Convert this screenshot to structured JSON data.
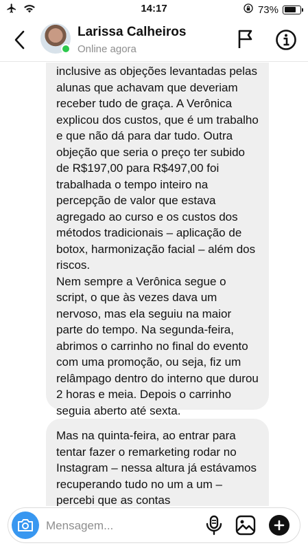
{
  "status_bar": {
    "time": "14:17",
    "battery": "73%",
    "battery_level": 0.73
  },
  "header": {
    "contact_name": "Larissa Calheiros",
    "status": "Online agora"
  },
  "messages": [
    {
      "text": "inclusive as objeções levantadas pelas alunas que achavam que deveriam receber tudo de graça. A Verônica explicou dos custos, que é um trabalho e que não dá para dar tudo. Outra objeção que seria o preço ter subido de R$197,00 para R$497,00 foi trabalhada o tempo inteiro na percepção de valor que estava agregado ao curso e os custos dos métodos tradicionais – aplicação de botox, harmonização facial – além dos riscos.\nNem sempre a Verônica segue o script, o que às vezes dava um nervoso, mas ela seguiu na maior parte do tempo. Na segunda-feira, abrimos o carrinho no final do evento com uma promoção, ou seja, fiz um relâmpago dentro do interno que durou 2 horas e meia. Depois o carrinho seguia aberto até sexta."
    },
    {
      "text": "Mas na quinta-feira, ao entrar para tentar fazer o remarketing rodar no Instagram – nessa altura já estávamos recuperando tudo no um a um – percebi que as contas"
    }
  ],
  "composer": {
    "placeholder": "Mensagem..."
  },
  "colors": {
    "accent": "#3897f0",
    "online": "#2dc84d",
    "bubble": "#efefef"
  },
  "icons": [
    "airplane-icon",
    "wifi-icon",
    "rotation-lock-icon",
    "battery-icon",
    "back-arrow-icon",
    "flag-icon",
    "info-icon",
    "camera-icon",
    "microphone-icon",
    "gallery-icon",
    "plus-icon"
  ]
}
